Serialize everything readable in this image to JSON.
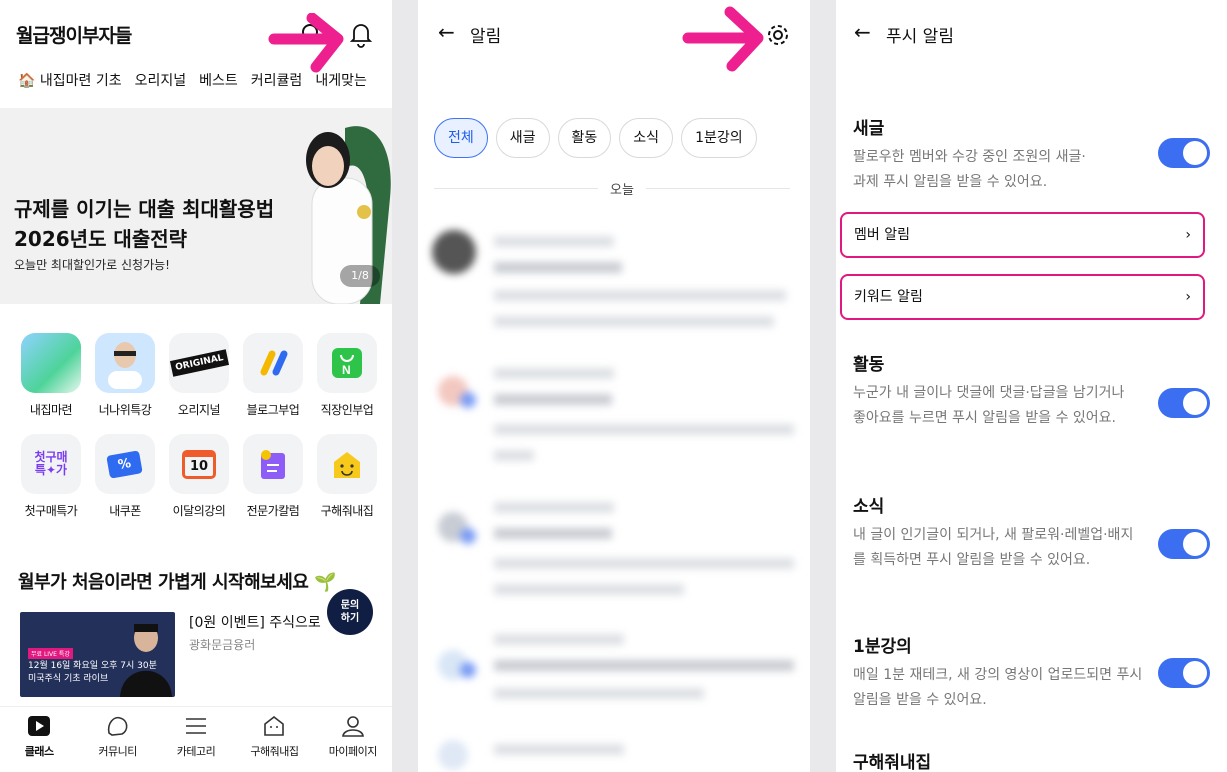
{
  "panel1": {
    "app_title": "월급쟁이부자들",
    "categories": [
      "🏠 내집마련 기초",
      "오리지널",
      "베스트",
      "커리큘럼",
      "내게맞는"
    ],
    "banner": {
      "title_line1": "규제를 이기는 대출 최대활용법",
      "title_line2": "2026년도 대출전략",
      "subtitle": "오늘만 최대할인가로 신청가능!",
      "page": "1/8"
    },
    "icons": [
      {
        "label": "내집마련",
        "name": "home-icon"
      },
      {
        "label": "너나위특강",
        "name": "lecturer-photo"
      },
      {
        "label": "오리지널",
        "name": "original-icon",
        "box_text": "ORIGINAL"
      },
      {
        "label": "블로그부업",
        "name": "blog-icon"
      },
      {
        "label": "직장인부업",
        "name": "job-icon"
      },
      {
        "label": "첫구매특가",
        "name": "first-purchase-icon",
        "box_text": "첫구매 특✦가"
      },
      {
        "label": "내쿠폰",
        "name": "coupon-icon",
        "box_text": "%"
      },
      {
        "label": "이달의강의",
        "name": "calendar-icon",
        "box_text": "10"
      },
      {
        "label": "전문가칼럼",
        "name": "column-icon"
      },
      {
        "label": "구해줘내집",
        "name": "house-smile-icon"
      }
    ],
    "section_title": "월부가 처음이라면 가볍게 시작해보세요 🌱",
    "event": {
      "thumb_tag": "무료 LIVE 특강",
      "thumb_line1": "12월 16일 화요일 오후 7시 30분",
      "thumb_line2": "미국주식 기초 라이브",
      "title": "[0원 이벤트] 주식으로",
      "sub": "광화문금융러"
    },
    "fab": {
      "line1": "문의",
      "line2": "하기"
    },
    "bottom_nav": [
      "클래스",
      "커뮤니티",
      "카테고리",
      "구해줘내집",
      "마이페이지"
    ]
  },
  "panel2": {
    "title": "알림",
    "chips": [
      "전체",
      "새글",
      "활동",
      "소식",
      "1분강의"
    ],
    "divider_label": "오늘"
  },
  "panel3": {
    "title": "푸시 알림",
    "sections": [
      {
        "heading": "새글",
        "desc": "팔로우한 멤버와 수강 중인 조원의 새글·과제 푸시 알림을 받을 수 있어요.",
        "on": true
      },
      {
        "heading": "활동",
        "desc": "누군가 내 글이나 댓글에 댓글·답글을 남기거나 좋아요를 누르면 푸시 알림을 받을 수 있어요.",
        "on": true
      },
      {
        "heading": "소식",
        "desc": "내 글이 인기글이 되거나, 새 팔로워·레벨업·배지를 획득하면 푸시 알림을 받을 수 있어요.",
        "on": true
      },
      {
        "heading": "1분강의",
        "desc": "매일 1분 재테크, 새 강의 영상이 업로드되면 푸시 알림을 받을 수 있어요.",
        "on": true
      },
      {
        "heading": "구해줘내집"
      }
    ],
    "links": [
      "멤버 알림",
      "키워드 알림"
    ]
  },
  "colors": {
    "accent": "#3b6ef0",
    "highlight": "#e0187f",
    "arrow": "#ee1f8f"
  }
}
